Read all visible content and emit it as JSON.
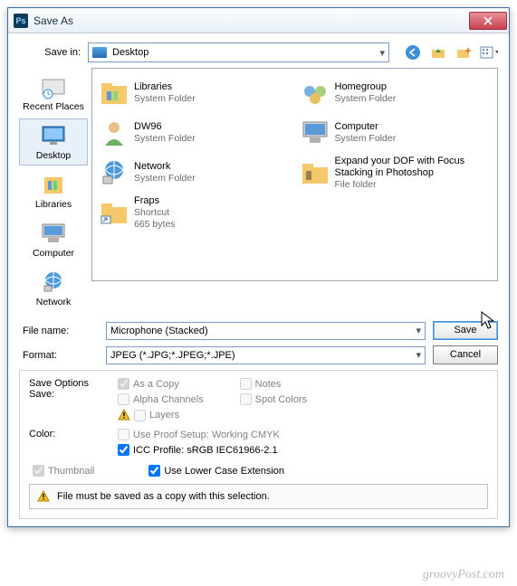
{
  "window": {
    "title": "Save As"
  },
  "savein": {
    "label": "Save in:",
    "value": "Desktop"
  },
  "places": [
    {
      "label": "Recent Places"
    },
    {
      "label": "Desktop"
    },
    {
      "label": "Libraries"
    },
    {
      "label": "Computer"
    },
    {
      "label": "Network"
    }
  ],
  "files": [
    {
      "name": "Libraries",
      "sub": "System Folder"
    },
    {
      "name": "Homegroup",
      "sub": "System Folder"
    },
    {
      "name": "DW96",
      "sub": "System Folder"
    },
    {
      "name": "Computer",
      "sub": "System Folder"
    },
    {
      "name": "Network",
      "sub": "System Folder"
    },
    {
      "name": "Expand your DOF with Focus Stacking in Photoshop",
      "sub": "File folder"
    },
    {
      "name": "Fraps",
      "sub": "Shortcut",
      "sub2": "665 bytes"
    }
  ],
  "fields": {
    "filename_label": "File name:",
    "filename_value": "Microphone (Stacked)",
    "format_label": "Format:",
    "format_value": "JPEG (*.JPG;*.JPEG;*.JPE)"
  },
  "buttons": {
    "save": "Save",
    "cancel": "Cancel"
  },
  "options": {
    "group_title": "Save Options",
    "save_label": "Save:",
    "as_copy": "As a Copy",
    "notes": "Notes",
    "alpha": "Alpha Channels",
    "spot": "Spot Colors",
    "layers": "Layers",
    "color_label": "Color:",
    "proof": "Use Proof Setup:   Working CMYK",
    "icc": "ICC Profile: sRGB IEC61966-2.1",
    "thumbnail": "Thumbnail",
    "lowercase": "Use Lower Case Extension",
    "message": "File must be saved as a copy with this selection."
  },
  "watermark": "groovyPost.com"
}
